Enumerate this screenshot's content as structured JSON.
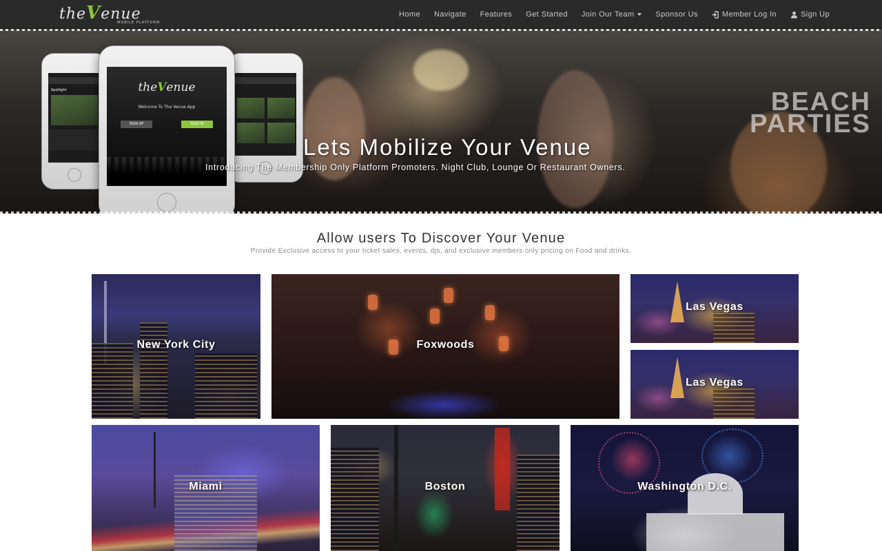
{
  "brand": {
    "name_prefix": "the",
    "name_v": "V",
    "name_suffix": "enue",
    "tagline": "MOBILE PLATFORM"
  },
  "nav": {
    "items": [
      {
        "label": "Home"
      },
      {
        "label": "Navigate"
      },
      {
        "label": "Features"
      },
      {
        "label": "Get Started"
      },
      {
        "label": "Join Our Team"
      },
      {
        "label": "Sponsor Us"
      },
      {
        "label": "Member Log In",
        "icon": "sign-in-icon"
      },
      {
        "label": "Sign Up",
        "icon": "user-icon"
      }
    ]
  },
  "hero": {
    "badge_line1": "BEACH",
    "badge_line2": "PARTIES",
    "title": "Lets Mobilize Your Venue",
    "subtitle": "Introducing The Membership Only Platform Promoters. Night Club, Lounge Or Restaurant Owners.",
    "phone": {
      "welcome": "Welcome To The Venue App",
      "sign_up": "SIGN UP",
      "sign_in": "SIGN IN",
      "spotlight": "Spotlight"
    }
  },
  "discover": {
    "title": "Allow users To Discover Your Venue",
    "subtitle": "Provide Exclusive access to your ticket sales. events, djs, and exclusive members only pricing on Food and drinks.",
    "venues": [
      {
        "name": "New York City"
      },
      {
        "name": "Foxwoods"
      },
      {
        "name": "Las Vegas"
      },
      {
        "name": "Las Vegas"
      },
      {
        "name": "Miami"
      },
      {
        "name": "Boston"
      },
      {
        "name": "Washington D.C."
      }
    ]
  },
  "colors": {
    "navbar_bg": "#2a2a2a",
    "brand_accent": "#8cc63f",
    "nav_text": "#c9c9c9"
  }
}
